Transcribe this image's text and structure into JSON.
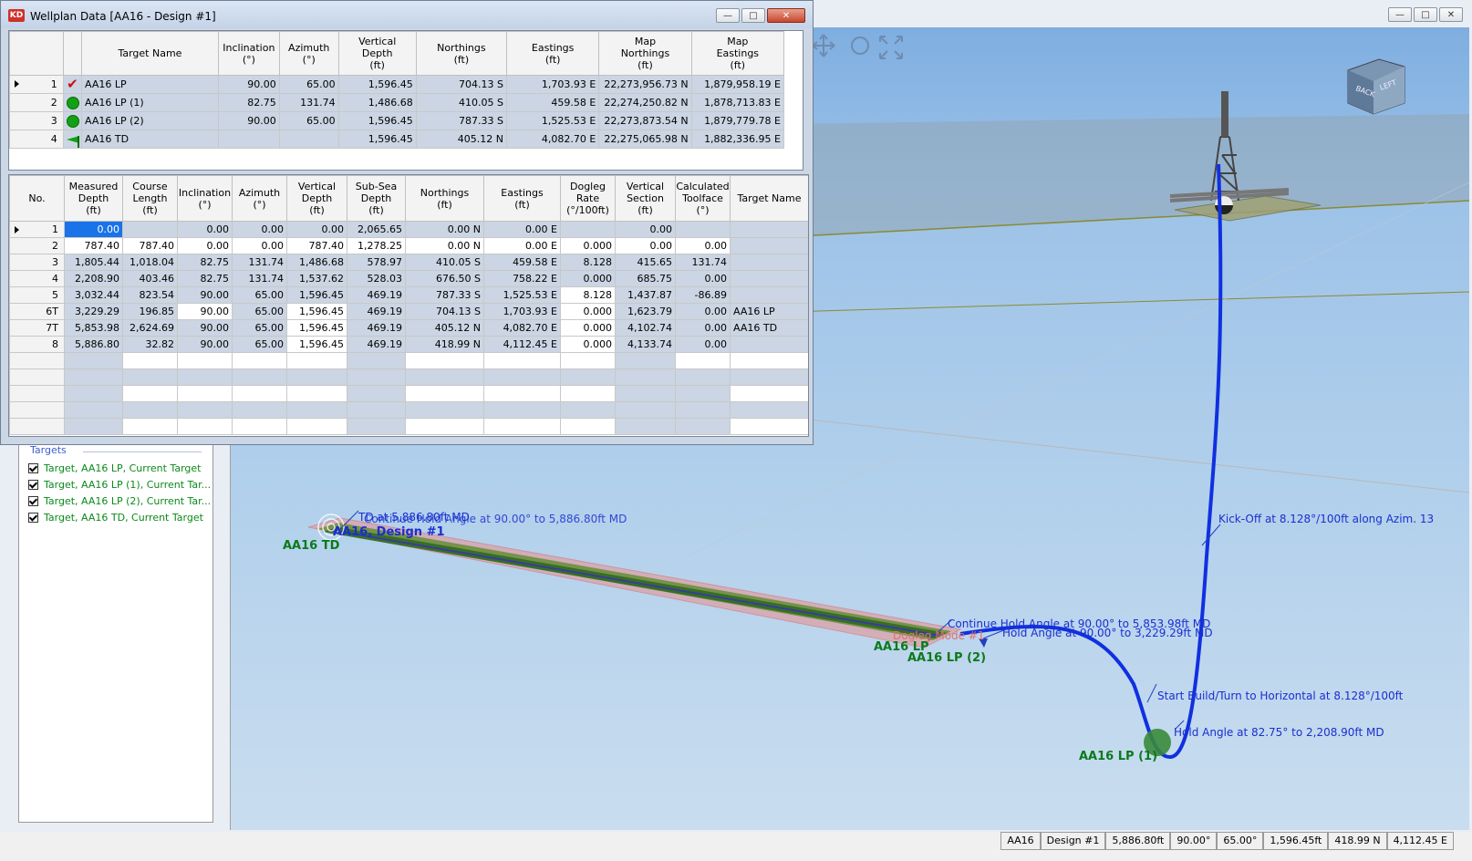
{
  "main_window": {},
  "viewport": {
    "annotations": {
      "kickoff": "Kick-Off at 8.128°/100ft along Azim. 13",
      "continue_hold": "Continue Hold Angle at 90.00° to 5,853.98ft MD",
      "hold_3229": "Hold Angle at 90.00° to 3,229.29ft MD",
      "start_build": "Start Build/Turn to Horizontal at 8.128°/100ft",
      "hold_2208": "Hold Angle at 82.75° to 2,208.90ft MD",
      "td_overlap_a": "TD at 5,886.80ft MD",
      "td_overlap_b": "Continue Hold Angle at 90.00° to 5,886.80ft MD",
      "design_label": "AA16, Design #1",
      "dogleg": "Dogleg Mode #1"
    },
    "target_labels": {
      "td": "AA16 TD",
      "lp": "AA16 LP",
      "lp2": "AA16 LP (2)",
      "lp1": "AA16 LP (1)"
    },
    "view_cube": {
      "back": "BACK",
      "left": "LEFT"
    }
  },
  "side_panel": {
    "group_title": "Targets",
    "items": [
      "Target, AA16 LP, Current Target",
      "Target, AA16 LP (1), Current Tar...",
      "Target, AA16 LP (2), Current Tar...",
      "Target, AA16 TD, Current Target"
    ]
  },
  "status_bar": [
    "AA16",
    "Design #1",
    "5,886.80ft",
    "90.00°",
    "65.00°",
    "1,596.45ft",
    "418.99 N",
    "4,112.45 E"
  ],
  "dialog": {
    "icon_text": "KD",
    "title": "Wellplan Data [AA16 - Design #1]",
    "targets_table": {
      "headers": [
        "Target Name",
        "Inclination\n(°)",
        "Azimuth\n(°)",
        "Vertical\nDepth\n(ft)",
        "Northings\n(ft)",
        "Eastings\n(ft)",
        "Map\nNorthings\n(ft)",
        "Map\nEastings\n(ft)"
      ],
      "rows": [
        {
          "no": "1",
          "icon": "check",
          "name": "AA16 LP",
          "inc": "90.00",
          "azi": "65.00",
          "tvd": "1,596.45",
          "north": "704.13 S",
          "east": "1,703.93 E",
          "mapn": "22,273,956.73 N",
          "mape": "1,879,958.19 E"
        },
        {
          "no": "2",
          "icon": "circle",
          "name": "AA16 LP (1)",
          "inc": "82.75",
          "azi": "131.74",
          "tvd": "1,486.68",
          "north": "410.05 S",
          "east": "459.58 E",
          "mapn": "22,274,250.82 N",
          "mape": "1,878,713.83 E"
        },
        {
          "no": "3",
          "icon": "circle",
          "name": "AA16 LP (2)",
          "inc": "90.00",
          "azi": "65.00",
          "tvd": "1,596.45",
          "north": "787.33 S",
          "east": "1,525.53 E",
          "mapn": "22,273,873.54 N",
          "mape": "1,879,779.78 E"
        },
        {
          "no": "4",
          "icon": "flag",
          "name": "AA16 TD",
          "inc": "",
          "azi": "",
          "tvd": "1,596.45",
          "north": "405.12 N",
          "east": "4,082.70 E",
          "mapn": "22,275,065.98 N",
          "mape": "1,882,336.95 E"
        }
      ]
    },
    "survey_table": {
      "headers": [
        "No.",
        "Measured\nDepth\n(ft)",
        "Course\nLength\n(ft)",
        "Inclination\n(°)",
        "Azimuth\n(°)",
        "Vertical\nDepth\n(ft)",
        "Sub-Sea\nDepth\n(ft)",
        "Northings\n(ft)",
        "Eastings\n(ft)",
        "Dogleg\nRate\n(°/100ft)",
        "Vertical\nSection\n(ft)",
        "Calculated\nToolface\n(°)",
        "Target Name"
      ],
      "rows": [
        [
          "1",
          "0.00",
          "",
          "0.00",
          "0.00",
          "0.00",
          "2,065.65",
          "0.00 N",
          "0.00 E",
          "",
          "0.00",
          "",
          ""
        ],
        [
          "2",
          "787.40",
          "787.40",
          "0.00",
          "0.00",
          "787.40",
          "1,278.25",
          "0.00 N",
          "0.00 E",
          "0.000",
          "0.00",
          "0.00",
          ""
        ],
        [
          "3",
          "1,805.44",
          "1,018.04",
          "82.75",
          "131.74",
          "1,486.68",
          "578.97",
          "410.05 S",
          "459.58 E",
          "8.128",
          "415.65",
          "131.74",
          ""
        ],
        [
          "4",
          "2,208.90",
          "403.46",
          "82.75",
          "131.74",
          "1,537.62",
          "528.03",
          "676.50 S",
          "758.22 E",
          "0.000",
          "685.75",
          "0.00",
          ""
        ],
        [
          "5",
          "3,032.44",
          "823.54",
          "90.00",
          "65.00",
          "1,596.45",
          "469.19",
          "787.33 S",
          "1,525.53 E",
          "8.128",
          "1,437.87",
          "-86.89",
          ""
        ],
        [
          "6T",
          "3,229.29",
          "196.85",
          "90.00",
          "65.00",
          "1,596.45",
          "469.19",
          "704.13 S",
          "1,703.93 E",
          "0.000",
          "1,623.79",
          "0.00",
          "AA16 LP"
        ],
        [
          "7T",
          "5,853.98",
          "2,624.69",
          "90.00",
          "65.00",
          "1,596.45",
          "469.19",
          "405.12 N",
          "4,082.70 E",
          "0.000",
          "4,102.74",
          "0.00",
          "AA16 TD"
        ],
        [
          "8",
          "5,886.80",
          "32.82",
          "90.00",
          "65.00",
          "1,596.45",
          "469.19",
          "418.99 N",
          "4,112.45 E",
          "0.000",
          "4,133.74",
          "0.00",
          ""
        ]
      ]
    }
  }
}
